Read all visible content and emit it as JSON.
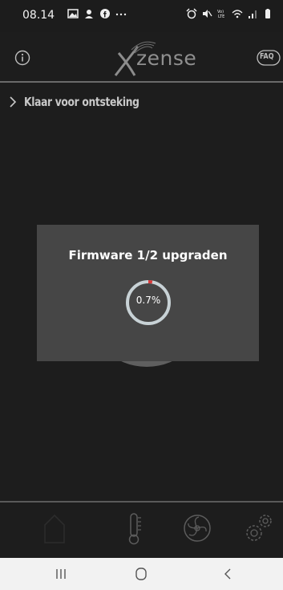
{
  "status_bar": {
    "time": "08.14",
    "left_icons": [
      "gallery-icon",
      "notification-icon",
      "facebook-icon",
      "more-dots-icon"
    ],
    "right_icons": [
      "alarm-icon",
      "mute-icon",
      "volte-icon",
      "wifi-icon",
      "signal-icon",
      "battery-icon"
    ],
    "volte_text": "Vo)) LTE"
  },
  "header": {
    "brand": "zense",
    "faq_label": "FAQ",
    "info_icon": "info-icon"
  },
  "status": {
    "text": "Klaar voor ontsteking"
  },
  "modal": {
    "title": "Firmware 1/2 upgraden",
    "progress_text": "0.7%",
    "progress_percent": 0.7,
    "track_color": "#c8d2d6",
    "fill_color": "#d93a3a"
  },
  "tabbar": {
    "tabs": [
      {
        "name": "home",
        "icon": "home-icon"
      },
      {
        "name": "temperature",
        "icon": "thermometer-icon"
      },
      {
        "name": "fan",
        "icon": "fan-icon"
      },
      {
        "name": "settings",
        "icon": "gears-icon"
      }
    ]
  },
  "navbar": {
    "buttons": [
      "recent-apps-icon",
      "home-circle-icon",
      "back-icon"
    ]
  },
  "colors": {
    "background": "#1d1d1d",
    "modal": "#464646",
    "navbar": "#f2f2f2"
  }
}
